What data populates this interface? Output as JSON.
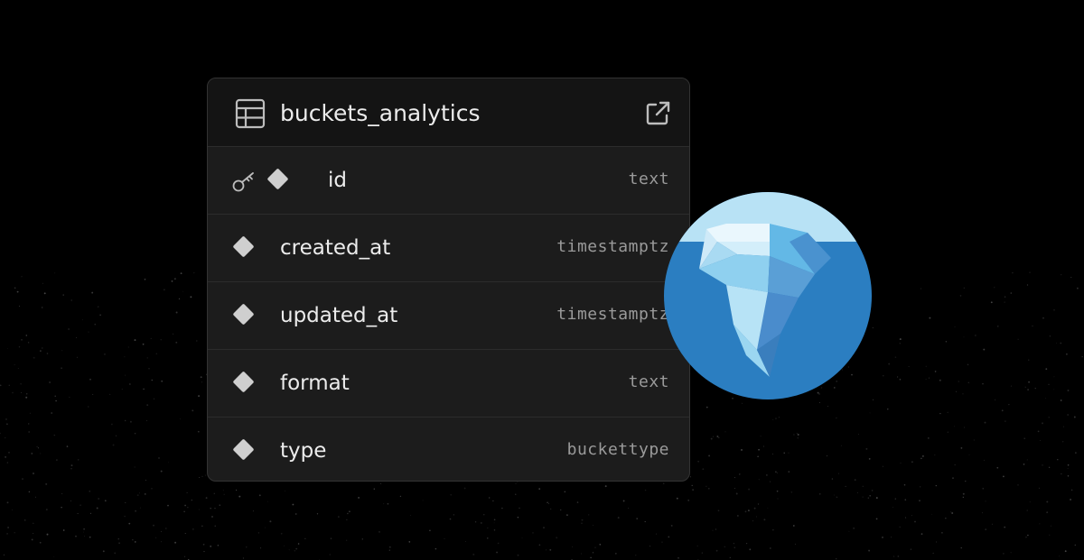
{
  "table": {
    "name": "buckets_analytics",
    "columns": [
      {
        "name": "id",
        "type": "text",
        "primary_key": true
      },
      {
        "name": "created_at",
        "type": "timestamptz",
        "primary_key": false
      },
      {
        "name": "updated_at",
        "type": "timestamptz",
        "primary_key": false
      },
      {
        "name": "format",
        "type": "text",
        "primary_key": false
      },
      {
        "name": "type",
        "type": "buckettype",
        "primary_key": false
      }
    ]
  },
  "icons": {
    "table": "table-grid-icon",
    "open": "external-link-icon",
    "primary_key": "key-icon",
    "column": "diamond-icon",
    "logo": "iceberg-logo"
  },
  "colors": {
    "background": "#000000",
    "card": "#1c1c1c",
    "header": "#141414",
    "text": "#ececec",
    "type_text": "#9a9a9a",
    "logo_water": "#2b7ec1",
    "logo_sky": "#b8e2f5"
  }
}
